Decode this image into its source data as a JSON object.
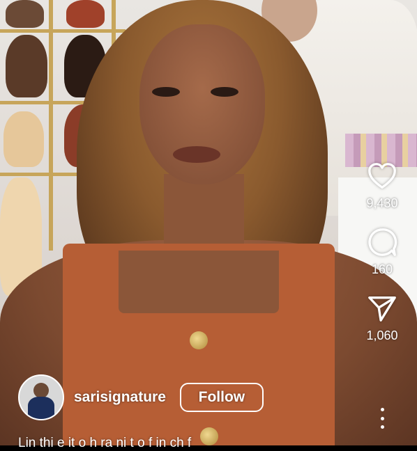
{
  "post": {
    "username": "sarisignature",
    "follow_label": "Follow",
    "caption": "Lin thi e it o h ra ni t o f in ch f"
  },
  "actions": {
    "likes": "9,430",
    "comments": "160",
    "shares": "1,060"
  },
  "icons": {
    "like": "heart-icon",
    "comment": "comment-bubble-icon",
    "share": "paper-plane-icon",
    "more": "more-vertical-icon"
  },
  "colors": {
    "overlay_text": "#ffffff"
  }
}
